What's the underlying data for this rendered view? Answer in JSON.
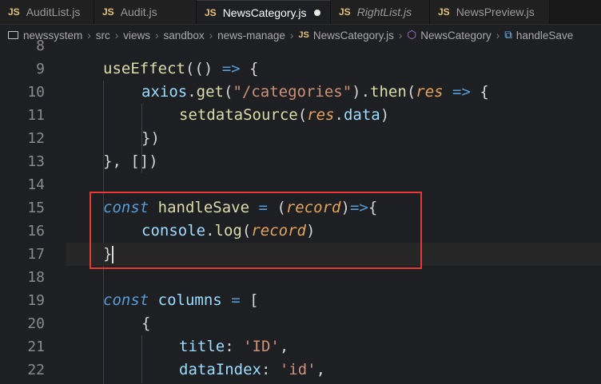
{
  "tabs": [
    {
      "icon": "JS",
      "label": "AuditList.js",
      "active": false,
      "italic": false
    },
    {
      "icon": "JS",
      "label": "Audit.js",
      "active": false,
      "italic": false
    },
    {
      "icon": "JS",
      "label": "NewsCategory.js",
      "active": true,
      "italic": false,
      "modified": true
    },
    {
      "icon": "JS",
      "label": "RightList.js",
      "active": false,
      "italic": true
    },
    {
      "icon": "JS",
      "label": "NewsPreview.js",
      "active": false,
      "italic": false
    }
  ],
  "breadcrumb": [
    "newssystem",
    "src",
    "views",
    "sandbox",
    "news-manage",
    "NewsCategory.js",
    "NewsCategory",
    "handleSave"
  ],
  "lines": [
    {
      "n": "8",
      "t": ""
    },
    {
      "n": "9",
      "t": "useEffect(() => {"
    },
    {
      "n": "10",
      "t": "axios.get(\"/categories\").then(res => {"
    },
    {
      "n": "11",
      "t": "setdataSource(res.data)"
    },
    {
      "n": "12",
      "t": "})"
    },
    {
      "n": "13",
      "t": "}, [])"
    },
    {
      "n": "14",
      "t": ""
    },
    {
      "n": "15",
      "t": "const handleSave = (record)=>{"
    },
    {
      "n": "16",
      "t": "console.log(record)"
    },
    {
      "n": "17",
      "t": "}"
    },
    {
      "n": "18",
      "t": ""
    },
    {
      "n": "19",
      "t": "const columns = ["
    },
    {
      "n": "20",
      "t": "{"
    },
    {
      "n": "21",
      "t": "title: 'ID',"
    },
    {
      "n": "22",
      "t": "dataIndex: 'id',"
    }
  ],
  "colors": {
    "highlight_box": "#e53935",
    "js_icon": "#e5c07b"
  }
}
